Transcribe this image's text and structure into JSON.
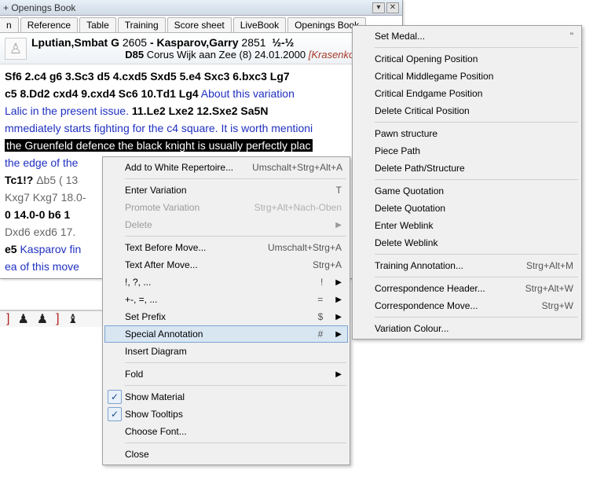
{
  "title": "+ Openings Book",
  "tabs": [
    "n",
    "Reference",
    "Table",
    "Training",
    "Score sheet",
    "LiveBook",
    "Openings Book"
  ],
  "header": {
    "p1_name": "Lputian,Smbat G",
    "p1_elo": "2605",
    "dash": " - ",
    "p2_name": "Kasparov,Garry",
    "p2_elo": "2851",
    "result": "½-½",
    "eco": "D85",
    "event": "Corus Wijk aan Zee (8) 24.01.2000",
    "annotator": "[Krasenkow,M]"
  },
  "notation": {
    "line1_a": "Sf6  2.c4  g6  3.Sc3  d5  4.cxd5  Sxd5  5.e4  Sxc3  6.bxc3  Lg7",
    "line2_a": "c5  8.Dd2  cxd4  9.cxd4  Sc6  10.Td1  Lg4",
    "line2_c": " About this variation",
    "line3_c": "Lalic in the present issue.",
    "line3_a": "  11.Le2  Lxe2  12.Sxe2  Sa5N",
    "line4_c": "mmediately starts fighting for the c4 square. It is worth mentioni",
    "line5_hl": "the Gruenfeld defence the black knight is usually perfectly plac",
    "line6_c": "the edge of the",
    "line7_a": "Tc1!? ",
    "line7_v": "Δb5  ( 13",
    "line8_a": "Kxg7 Kxg7  18.0-",
    "line9_a": "0 14.0-0 b6 1",
    "line10_a": "Dxd6 exd6  17.",
    "line11_a": "e5",
    "line11_c": " Kasparov fin",
    "line12_c": "ea of this move"
  },
  "menu1": [
    {
      "label": "Add to White Repertoire...",
      "shortcut": "Umschalt+Strg+Alt+A"
    },
    {
      "sep": true
    },
    {
      "label": "Enter Variation",
      "shortcut": "T"
    },
    {
      "label": "Promote Variation",
      "shortcut": "Strg+Alt+Nach-Oben",
      "disabled": true
    },
    {
      "label": "Delete",
      "arrow": true,
      "disabled": true
    },
    {
      "sep": true
    },
    {
      "label": "Text Before Move...",
      "shortcut": "Umschalt+Strg+A"
    },
    {
      "label": "Text After Move...",
      "shortcut": "Strg+A"
    },
    {
      "label": "!, ?, ...",
      "shortcut": "!",
      "arrow": true
    },
    {
      "label": "+-, =, ...",
      "shortcut": "=",
      "arrow": true
    },
    {
      "label": "Set Prefix",
      "shortcut": "$",
      "arrow": true
    },
    {
      "label": "Special Annotation",
      "shortcut": "#",
      "arrow": true,
      "hover": true
    },
    {
      "label": "Insert Diagram"
    },
    {
      "sep": true
    },
    {
      "label": "Fold",
      "arrow": true
    },
    {
      "sep": true
    },
    {
      "label": "Show Material",
      "check": true
    },
    {
      "label": "Show Tooltips",
      "check": true
    },
    {
      "label": "Choose Font..."
    },
    {
      "sep": true
    },
    {
      "label": "Close"
    }
  ],
  "menu2": [
    {
      "label": "Set Medal...",
      "shortcut": "\""
    },
    {
      "sep": true
    },
    {
      "label": "Critical Opening Position"
    },
    {
      "label": "Critical Middlegame Position"
    },
    {
      "label": "Critical Endgame Position"
    },
    {
      "label": "Delete Critical Position"
    },
    {
      "sep": true
    },
    {
      "label": "Pawn structure"
    },
    {
      "label": "Piece Path"
    },
    {
      "label": "Delete Path/Structure"
    },
    {
      "sep": true
    },
    {
      "label": "Game Quotation"
    },
    {
      "label": "Delete Quotation"
    },
    {
      "label": "Enter Weblink"
    },
    {
      "label": "Delete Weblink"
    },
    {
      "sep": true
    },
    {
      "label": "Training Annotation...",
      "shortcut": "Strg+Alt+M"
    },
    {
      "sep": true
    },
    {
      "label": "Correspondence Header...",
      "shortcut": "Strg+Alt+W"
    },
    {
      "label": "Correspondence Move...",
      "shortcut": "Strg+W"
    },
    {
      "sep": true
    },
    {
      "label": "Variation Colour..."
    }
  ],
  "bottom": {
    "brk1": "]",
    "brk2": "]"
  }
}
